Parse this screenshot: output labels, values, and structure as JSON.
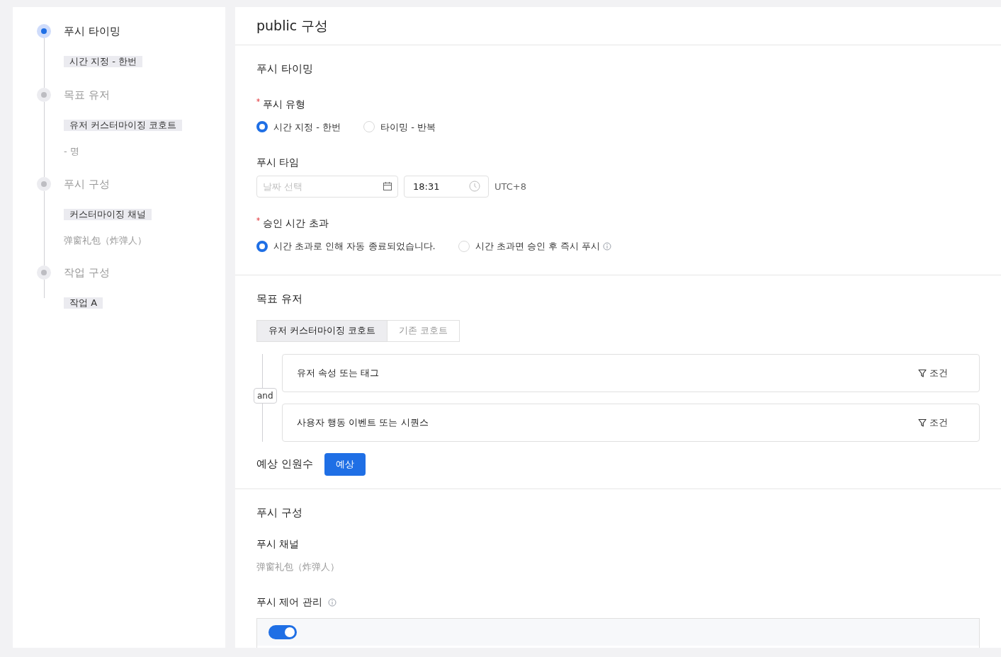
{
  "steps": [
    {
      "title": "푸시 타이밍",
      "active": true,
      "tag": "시간 지정 - 한번"
    },
    {
      "title": "목표 유저",
      "active": false,
      "tag": "유저 커스터마이징 코호트",
      "note": "- 명"
    },
    {
      "title": "푸시 구성",
      "active": false,
      "tag": "커스터마이징 채널",
      "note": "弹窗礼包（炸弹人）"
    },
    {
      "title": "작업 구성",
      "active": false,
      "tag": "작업 A"
    }
  ],
  "page_title": "public 구성",
  "timing": {
    "title": "푸시 타이밍",
    "push_type": {
      "label": "푸시 유형",
      "required": true,
      "options": [
        {
          "label": "시간 지정 - 한번",
          "selected": true
        },
        {
          "label": "타이밍 - 반복",
          "selected": false
        }
      ]
    },
    "push_time": {
      "label": "푸시 타임",
      "date_placeholder": "날짜 선택",
      "time_value": "18:31",
      "timezone": "UTC+8"
    },
    "timeout": {
      "label": "승인 시간 초과",
      "required": true,
      "options": [
        {
          "label": "시간 초과로 인해 자동 종료되었습니다.",
          "selected": true,
          "info": false
        },
        {
          "label": "시간 초과면 승인 후 즉시 푸시",
          "selected": false,
          "info": true
        }
      ]
    }
  },
  "target": {
    "title": "목표 유저",
    "tabs": [
      {
        "label": "유저 커스터마이징 코호트",
        "selected": true
      },
      {
        "label": "기존 코호트",
        "selected": false
      }
    ],
    "logic": "and",
    "conditions": [
      {
        "label": "유저 속성 또는 태그",
        "action": "조건"
      },
      {
        "label": "사용자 행동 이벤트 또는 시퀀스",
        "action": "조건"
      }
    ],
    "estimate_label": "예상 인원수",
    "estimate_button": "예상"
  },
  "config": {
    "title": "푸시 구성",
    "channel_label": "푸시 채널",
    "channel_value": "弹窗礼包（炸弹人）",
    "control_label": "푸시 제어 관리",
    "control_on": true
  }
}
